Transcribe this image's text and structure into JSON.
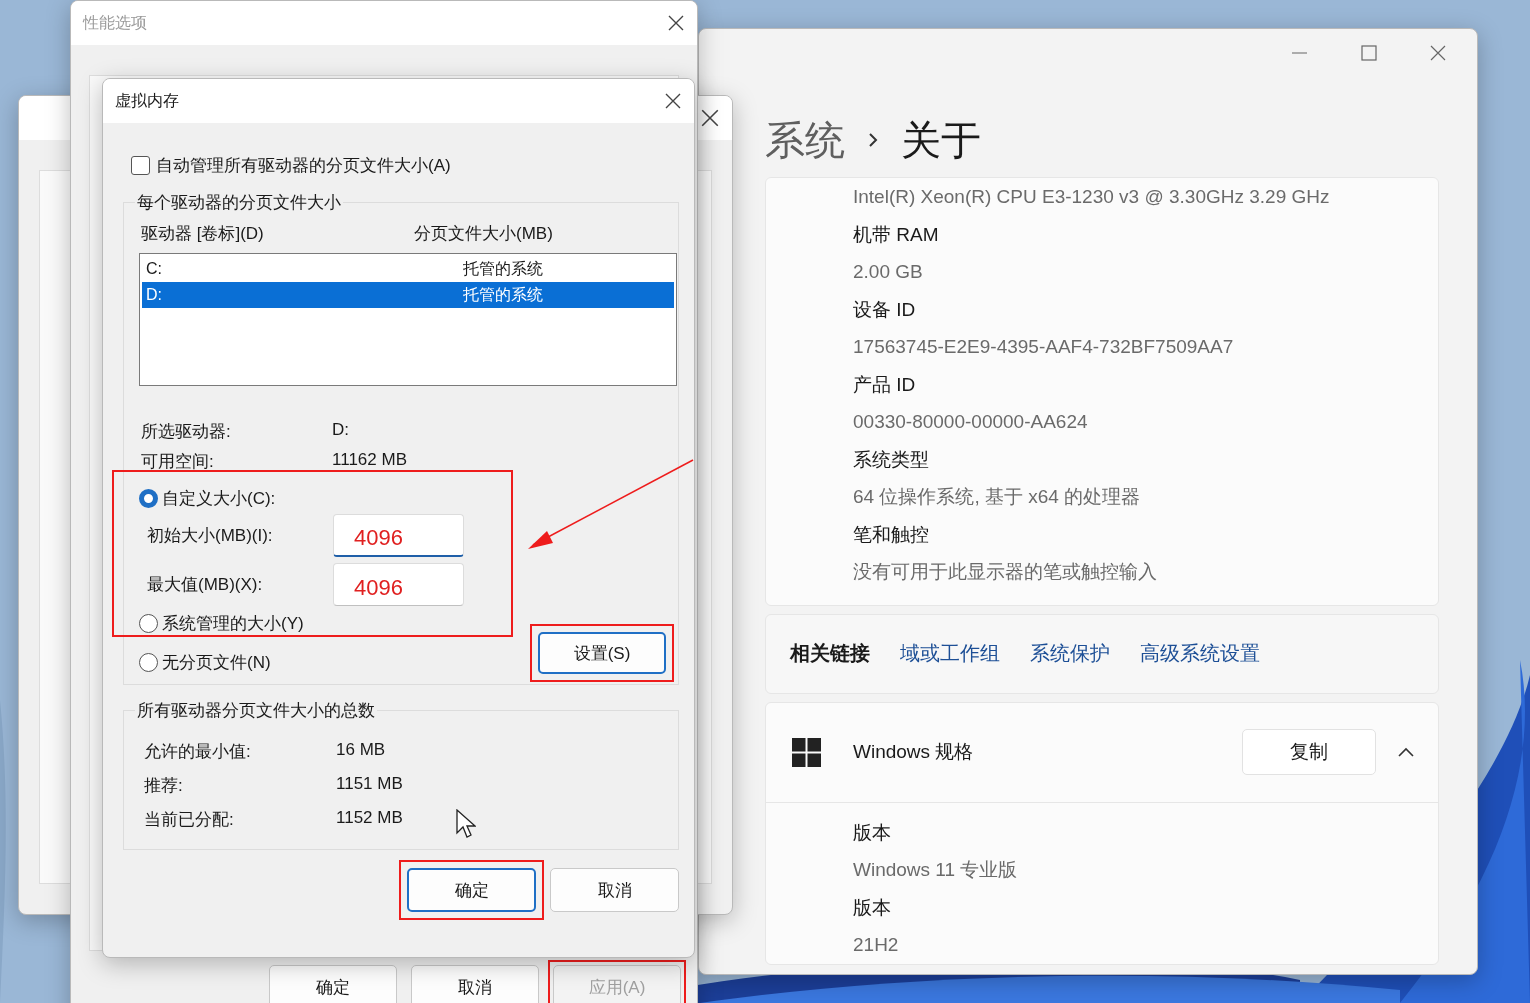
{
  "settings_window": {
    "breadcrumb": [
      "系统",
      "关于"
    ],
    "specs": [
      {
        "value": "Intel(R) Xeon(R) CPU E3-1230 v3 @ 3.30GHz   3.29 GHz"
      },
      {
        "label": "机带 RAM",
        "value": "2.00 GB"
      },
      {
        "label": "设备 ID",
        "value": "17563745-E2E9-4395-AAF4-732BF7509AA7"
      },
      {
        "label": "产品 ID",
        "value": "00330-80000-00000-AA624"
      },
      {
        "label": "系统类型",
        "value": "64 位操作系统, 基于 x64 的处理器"
      },
      {
        "label": "笔和触控",
        "value": "没有可用于此显示器的笔或触控输入"
      }
    ],
    "related_links": {
      "label": "相关链接",
      "links": [
        "域或工作组",
        "系统保护",
        "高级系统设置"
      ]
    },
    "windows_spec": {
      "title": "Windows 规格",
      "copy_button": "复制",
      "expanded": true,
      "rows": [
        {
          "label": "版本",
          "value": "Windows 11 专业版"
        },
        {
          "label": "版本",
          "value": "21H2"
        }
      ]
    }
  },
  "performance_window": {
    "title": "性能选项",
    "buttons": [
      {
        "label": "确定",
        "disabled": false
      },
      {
        "label": "取消",
        "disabled": false
      },
      {
        "label": "应用(A)",
        "disabled": true
      }
    ]
  },
  "virtual_memory": {
    "title": "虚拟内存",
    "auto_manage": {
      "label": "自动管理所有驱动器的分页文件大小(A)",
      "checked": false
    },
    "group_title": "每个驱动器的分页文件大小",
    "columns": [
      "驱动器 [卷标](D)",
      "分页文件大小(MB)"
    ],
    "drives": [
      {
        "drive": "C:",
        "size": "托管的系统",
        "selected": false
      },
      {
        "drive": "D:",
        "size": "托管的系统",
        "selected": true
      }
    ],
    "info": [
      {
        "label": "所选驱动器:",
        "value": "D:"
      },
      {
        "label": "可用空间:",
        "value": "11162 MB"
      }
    ],
    "options": [
      {
        "label": "自定义大小(C):",
        "selected": true
      },
      {
        "label": "系统管理的大小(Y)",
        "selected": false
      },
      {
        "label": "无分页文件(N)",
        "selected": false
      }
    ],
    "fields": [
      {
        "label": "初始大小(MB)(I):",
        "value": "4096",
        "focused": true
      },
      {
        "label": "最大值(MB)(X):",
        "value": "4096",
        "focused": false
      }
    ],
    "set_button": "设置(S)",
    "totals_title": "所有驱动器分页文件大小的总数",
    "totals": [
      {
        "label": "允许的最小值:",
        "value": "16 MB"
      },
      {
        "label": "推荐:",
        "value": "1151 MB"
      },
      {
        "label": "当前已分配:",
        "value": "1152 MB"
      }
    ],
    "buttons": [
      {
        "label": "确定",
        "default": true
      },
      {
        "label": "取消",
        "default": false
      }
    ]
  }
}
